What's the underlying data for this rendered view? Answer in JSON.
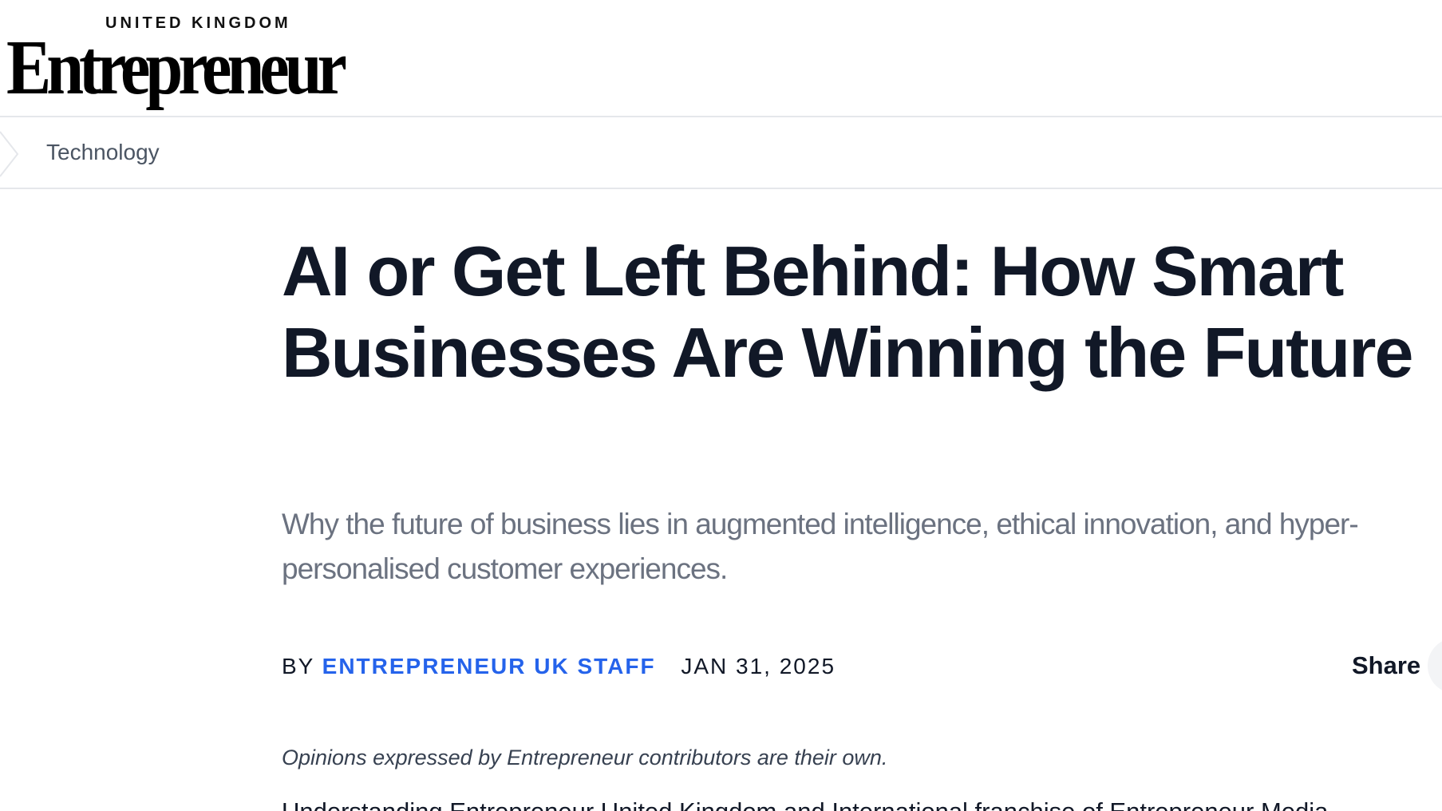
{
  "header": {
    "logo_region": "UNITED KINGDOM",
    "logo_wordmark": "Entrepreneur"
  },
  "breadcrumb": {
    "category": "Technology"
  },
  "article": {
    "headline": "AI or Get Left Behind: How Smart Businesses Are Winning the Future",
    "subtitle": "Why the future of business lies in augmented intelligence, ethical innovation, and hyper-personalised customer experiences.",
    "byline_prefix": "BY",
    "author": "ENTREPRENEUR UK STAFF",
    "date": "JAN 31, 2025",
    "share_label": "Share",
    "disclaimer": "Opinions expressed by Entrepreneur contributors are their own.",
    "body_first_line": "Understanding Entrepreneur United Kingdom and International franchise of Entrepreneur Media"
  },
  "colors": {
    "accent": "#2563eb",
    "headline": "#111827",
    "subtitle": "#6b7280",
    "divider": "#e5e7eb"
  },
  "icons": {
    "breadcrumb": "chevron-right-icon"
  }
}
